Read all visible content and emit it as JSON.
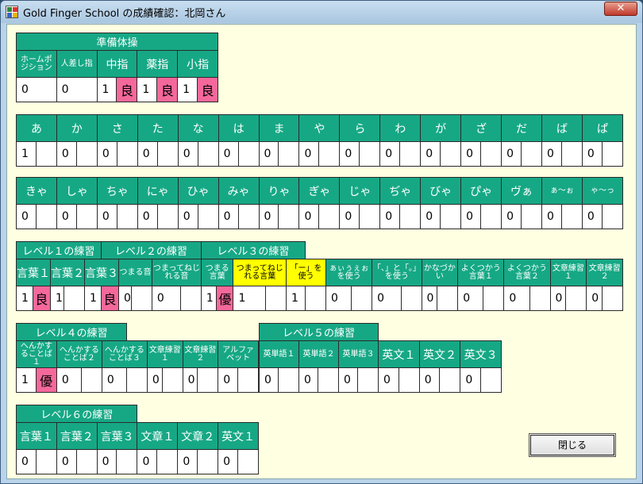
{
  "window": {
    "title": "Gold Finger School の成績確認：北岡さん",
    "close_glyph": "✕"
  },
  "warmup": {
    "title": "準備体操",
    "headers": [
      "ホームポジション",
      "人差し指",
      "中指",
      "薬指",
      "小指"
    ],
    "values": [
      "0",
      "0",
      "1",
      "1",
      "1"
    ],
    "grades": [
      "",
      "",
      "良",
      "良",
      "良"
    ]
  },
  "row1": {
    "headers": [
      "あ",
      "か",
      "さ",
      "た",
      "な",
      "は",
      "ま",
      "や",
      "ら",
      "わ",
      "が",
      "ざ",
      "だ",
      "ば",
      "ぱ"
    ],
    "values": [
      "1",
      "0",
      "0",
      "0",
      "0",
      "0",
      "0",
      "0",
      "0",
      "0",
      "0",
      "0",
      "0",
      "0",
      "0"
    ]
  },
  "row2": {
    "headers": [
      "きゃ",
      "しゃ",
      "ちゃ",
      "にゃ",
      "ひゃ",
      "みゃ",
      "りゃ",
      "ぎゃ",
      "じゃ",
      "ぢゃ",
      "びゃ",
      "ぴゃ",
      "ヴぁ",
      "ぁ～ぉ",
      "ゃ～っ"
    ],
    "values": [
      "0",
      "0",
      "0",
      "0",
      "0",
      "0",
      "0",
      "0",
      "0",
      "0",
      "0",
      "0",
      "0",
      "0",
      "0"
    ]
  },
  "level123": {
    "titles": [
      "レベル１の練習",
      "レベル２の練習",
      "レベル３の練習"
    ],
    "headers": [
      "言葉１",
      "言葉２",
      "言葉３",
      "つまる音",
      "つまってねじれる音",
      "つまる言葉",
      "つまってねじれる言葉",
      "「ー」を使う",
      "ぁぃぅぇぉを使う",
      "「、」と「。」を使う",
      "かなづかい",
      "よくつかう言葉１",
      "よくつかう言葉２",
      "文章練習１",
      "文章練習２"
    ],
    "values": [
      "1",
      "1",
      "1",
      "0",
      "0",
      "1",
      "1",
      "1",
      "0",
      "0",
      "0",
      "0",
      "0",
      "0",
      "0"
    ],
    "grades": [
      "良",
      "",
      "良",
      "",
      "",
      "優",
      "",
      "",
      "",
      "",
      "",
      "",
      "",
      "",
      ""
    ]
  },
  "level4": {
    "title": "レベル４の練習",
    "headers": [
      "へんかすることば１",
      "へんかすることば２",
      "へんかすることば３",
      "文章練習１",
      "文章練習２"
    ],
    "values": [
      "1",
      "0",
      "0",
      "0",
      "0"
    ],
    "grades": [
      "優",
      "",
      "",
      "",
      ""
    ]
  },
  "alphabet": {
    "header": "アルファベット",
    "value": "0"
  },
  "level5": {
    "title": "レベル５の練習",
    "headers": [
      "英単語１",
      "英単語２",
      "英単語３",
      "英文１",
      "英文２",
      "英文３"
    ],
    "values": [
      "0",
      "0",
      "0",
      "0",
      "0",
      "0"
    ]
  },
  "level6": {
    "title": "レベル６の練習",
    "headers": [
      "言葉１",
      "言葉２",
      "言葉３",
      "文章１",
      "文章２",
      "英文１"
    ],
    "values": [
      "0",
      "0",
      "0",
      "0",
      "0",
      "0"
    ]
  },
  "close_button": {
    "label": "閉じる"
  }
}
